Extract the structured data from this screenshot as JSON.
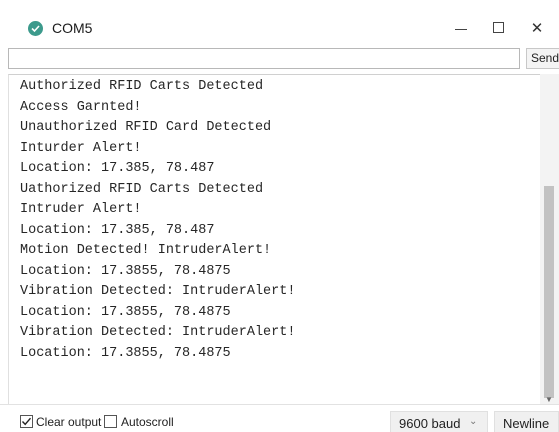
{
  "window": {
    "title": "COM5",
    "minimize_icon": "minimize-icon",
    "maximize_icon": "maximize-icon",
    "close_glyph": "✕"
  },
  "input": {
    "value": "",
    "send_label": "Send"
  },
  "console": {
    "lines": [
      "Authorized RFID Carts Detected",
      "Access Garnted!",
      "Unauthorized RFID Card Detected",
      "Inturder Alert!",
      "Location: 17.385, 78.487",
      "Uathorized RFID Carts Detected",
      "Intruder Alert!",
      "Location: 17.385, 78.487",
      "Motion Detected! IntruderAlert!",
      "Location: 17.3855, 78.4875",
      "Vibration Detected: IntruderAlert!",
      "Location: 17.3855, 78.4875",
      "Vibration Detected: IntruderAlert!",
      "Location: 17.3855, 78.4875"
    ]
  },
  "status": {
    "clear_output_label": "Clear output",
    "clear_output_checked": true,
    "autoscroll_label": "Autoscroll",
    "autoscroll_checked": false,
    "baud_value": "9600 baud",
    "line_ending_value": "Newline"
  },
  "colors": {
    "app_icon": "#3c9a8c",
    "console_text": "#262626"
  }
}
